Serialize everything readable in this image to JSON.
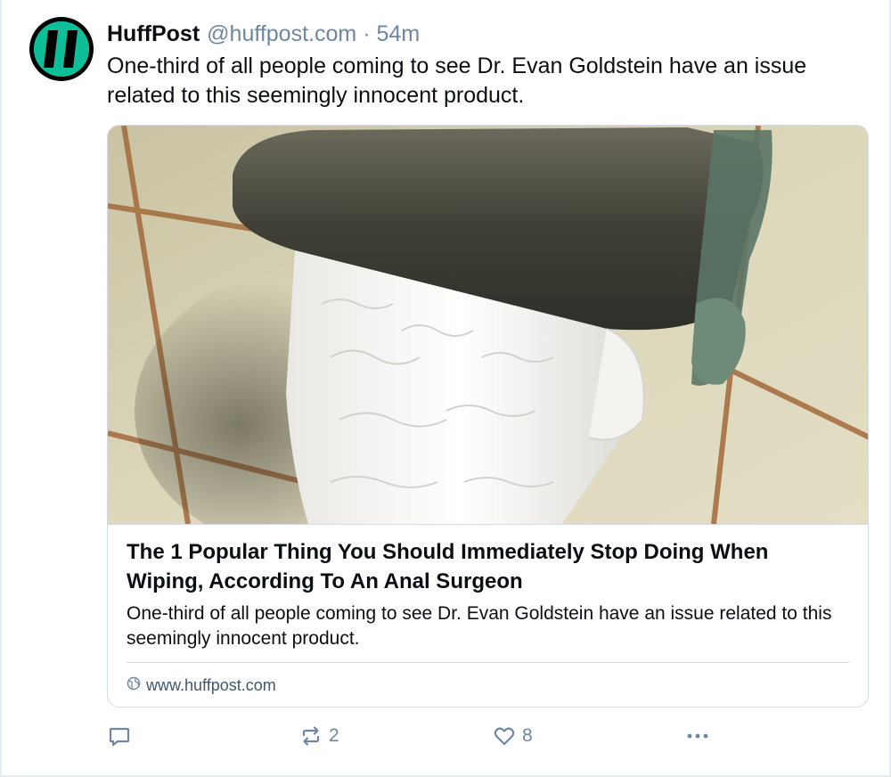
{
  "post": {
    "author_name": "HuffPost",
    "handle": "@huffpost.com",
    "separator": "·",
    "timestamp": "54m",
    "text": "One-third of all people coming to see Dr. Evan Goldstein have an issue related to this seemingly innocent product."
  },
  "link_card": {
    "image_subject": "toilet paper roll on metal holder against tiled wall",
    "title": "The 1 Popular Thing You Should Immediately Stop Doing When Wiping, According To An Anal Surgeon",
    "description": "One-third of all people coming to see Dr. Evan Goldstein have an issue related to this seemingly innocent product.",
    "domain": "www.huffpost.com"
  },
  "actions": {
    "reply_icon": "reply-icon",
    "reply_count": "",
    "repost_icon": "repost-icon",
    "repost_count": "2",
    "like_icon": "heart-icon",
    "like_count": "8",
    "more_icon": "more-icon"
  },
  "colors": {
    "brand_green": "#0dbe98",
    "muted_text": "#6f869f",
    "border": "#d4dbe2"
  }
}
